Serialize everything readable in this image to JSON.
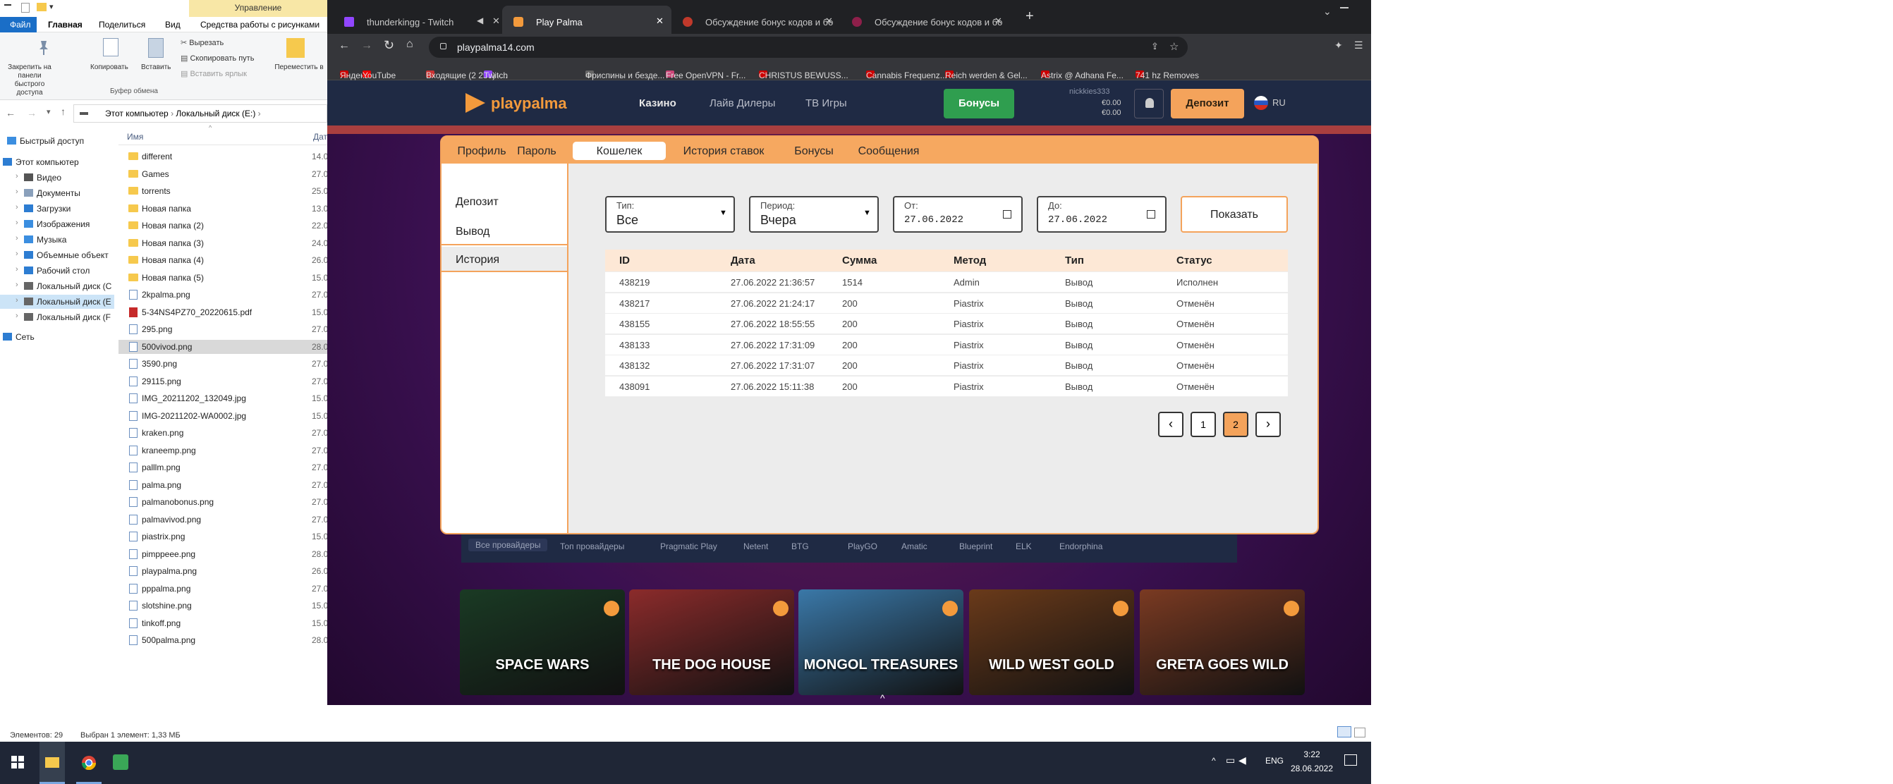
{
  "explorer": {
    "ribbon_tabs": [
      "Файл",
      "Главная",
      "Поделиться",
      "Вид",
      "Средства работы с рисунками"
    ],
    "manage_label": "Управление",
    "ribbon": {
      "pin_label": "Закрепить на панели быстрого доступа",
      "copy_label": "Копировать",
      "paste_label": "Вставить",
      "cut_label": "Вырезать",
      "copy_path_label": "Скопировать путь",
      "paste_shortcut_label": "Вставить ярлык",
      "move_label": "Переместить в",
      "clipboard_group": "Буфер обмена"
    },
    "breadcrumb": [
      "Этот компьютер",
      "Локальный диск (E:)"
    ],
    "name_column": "Имя",
    "date_column": "Дат",
    "tree": [
      "Быстрый доступ",
      "Этот компьютер",
      "Видео",
      "Документы",
      "Загрузки",
      "Изображения",
      "Музыка",
      "Объемные объект",
      "Рабочий стол",
      "Локальный диск (C",
      "Локальный диск (E",
      "Локальный диск (F",
      "Сеть"
    ],
    "files": [
      {
        "name": "different",
        "date": "14.0",
        "kind": "folder"
      },
      {
        "name": "Games",
        "date": "27.0",
        "kind": "folder"
      },
      {
        "name": "torrents",
        "date": "25.0",
        "kind": "folder"
      },
      {
        "name": "Новая папка",
        "date": "13.0",
        "kind": "folder"
      },
      {
        "name": "Новая папка (2)",
        "date": "22.0",
        "kind": "folder"
      },
      {
        "name": "Новая папка (3)",
        "date": "24.0",
        "kind": "folder"
      },
      {
        "name": "Новая папка (4)",
        "date": "26.0",
        "kind": "folder"
      },
      {
        "name": "Новая папка (5)",
        "date": "15.0",
        "kind": "folder"
      },
      {
        "name": "2kpalma.png",
        "date": "27.0",
        "kind": "image"
      },
      {
        "name": "5-34NS4PZ70_20220615.pdf",
        "date": "15.0",
        "kind": "pdf"
      },
      {
        "name": "295.png",
        "date": "27.0",
        "kind": "image"
      },
      {
        "name": "500vivod.png",
        "date": "28.0",
        "kind": "image"
      },
      {
        "name": "3590.png",
        "date": "27.0",
        "kind": "image"
      },
      {
        "name": "29115.png",
        "date": "27.0",
        "kind": "image"
      },
      {
        "name": "IMG_20211202_132049.jpg",
        "date": "15.0",
        "kind": "image"
      },
      {
        "name": "IMG-20211202-WA0002.jpg",
        "date": "15.0",
        "kind": "image"
      },
      {
        "name": "kraken.png",
        "date": "27.0",
        "kind": "image"
      },
      {
        "name": "kraneemp.png",
        "date": "27.0",
        "kind": "image"
      },
      {
        "name": "palllm.png",
        "date": "27.0",
        "kind": "image"
      },
      {
        "name": "palma.png",
        "date": "27.0",
        "kind": "image"
      },
      {
        "name": "palmanobonus.png",
        "date": "27.0",
        "kind": "image"
      },
      {
        "name": "palmavivod.png",
        "date": "27.0",
        "kind": "image"
      },
      {
        "name": "piastrix.png",
        "date": "15.0",
        "kind": "image"
      },
      {
        "name": "pimppeee.png",
        "date": "28.0",
        "kind": "image"
      },
      {
        "name": "playpalma.png",
        "date": "26.0",
        "kind": "image"
      },
      {
        "name": "pppalma.png",
        "date": "27.0",
        "kind": "image"
      },
      {
        "name": "slotshine.png",
        "date": "15.0",
        "kind": "image"
      },
      {
        "name": "tinkoff.png",
        "date": "15.0",
        "kind": "image"
      },
      {
        "name": "500palma.png",
        "date": "28.0",
        "kind": "image"
      }
    ],
    "selected_file": "500vivod.png",
    "status_count": "Элементов: 29",
    "status_selected": "Выбран 1 элемент: 1,33 МБ"
  },
  "taskbar": {
    "lang": "ENG",
    "time": "3:22",
    "date": "28.06.2022"
  },
  "browser": {
    "tabs": [
      "thunderkingg - Twitch",
      "Play Palma",
      "Обсуждение бонус кодов и бо",
      "Обсуждение бонус кодов и бо"
    ],
    "active_tab": 1,
    "url": "playpalma14.com",
    "bookmarks": [
      "Яндекс",
      "YouTube",
      "Входящие (2 255) -...",
      "Twitch",
      "Фриспины и бездe...",
      "Free OpenVPN - Fr...",
      "CHRISTUS BEWUSS...",
      "Cannabis Frequenz...",
      "Reich werden & Gel...",
      "Astrix @ Adhana Fe...",
      "741 hz Removes"
    ]
  },
  "site": {
    "logo": "playpalma",
    "nav": [
      "Казино",
      "Лайв Дилеры",
      "ТВ Игры"
    ],
    "bonus_button": "Бонусы",
    "user_name": "nickkies333",
    "balance1": "€0.00",
    "balance2": "€0.00",
    "deposit_button": "Депозит",
    "lang": "RU",
    "providers": [
      "Все провайдеры",
      "Топ провайдеры",
      "Pragmatic Play",
      "Netent",
      "BTG",
      "PlayGO",
      "Amatic",
      "Blueprint",
      "ELK",
      "Endorphina"
    ],
    "games": [
      "SPACE WARS",
      "THE DOG HOUSE",
      "MONGOL TREASURES",
      "WILD WEST GOLD",
      "GRETA GOES WILD"
    ]
  },
  "modal": {
    "tabs": [
      "Профиль",
      "Пароль",
      "Кошелек",
      "История ставок",
      "Бонусы",
      "Сообщения"
    ],
    "active_tab": "Кошелек",
    "side": [
      "Депозит",
      "Вывод",
      "История"
    ],
    "filters": {
      "type_label": "Тип:",
      "type_value": "Все",
      "period_label": "Период:",
      "period_value": "Вчера",
      "from_label": "От:",
      "from_value": "27.06.2022",
      "to_label": "До:",
      "to_value": "27.06.2022",
      "show_button": "Показать"
    },
    "table": {
      "headers": [
        "ID",
        "Дата",
        "Сумма",
        "Метод",
        "Тип",
        "Статус"
      ],
      "rows": [
        [
          "438219",
          "27.06.2022 21:36:57",
          "1514",
          "Admin",
          "Вывод",
          "Исполнен"
        ],
        [
          "438217",
          "27.06.2022 21:24:17",
          "200",
          "Piastrix",
          "Вывод",
          "Отменён"
        ],
        [
          "438155",
          "27.06.2022 18:55:55",
          "200",
          "Piastrix",
          "Вывод",
          "Отменён"
        ],
        [
          "438133",
          "27.06.2022 17:31:09",
          "200",
          "Piastrix",
          "Вывод",
          "Отменён"
        ],
        [
          "438132",
          "27.06.2022 17:31:07",
          "200",
          "Piastrix",
          "Вывод",
          "Отменён"
        ],
        [
          "438091",
          "27.06.2022 15:11:38",
          "200",
          "Piastrix",
          "Вывод",
          "Отменён"
        ]
      ]
    },
    "pagination": [
      "1",
      "2"
    ],
    "current_page": "2"
  },
  "colors": {
    "accent": "#f6a860",
    "bonus_green": "#2f9e4f",
    "page_active": "#f4a35b"
  }
}
